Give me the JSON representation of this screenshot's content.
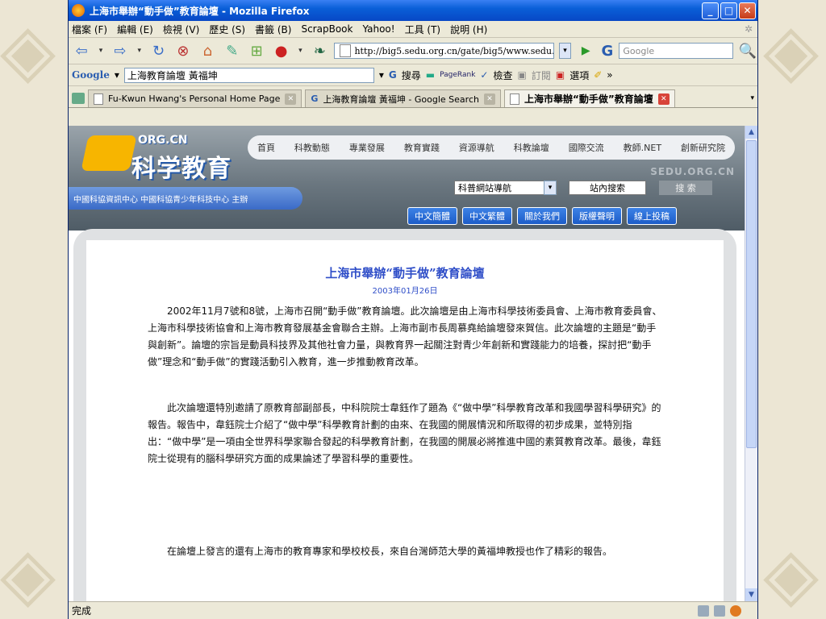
{
  "window": {
    "title": "上海市舉辦“動手做”教育論壇 - Mozilla Firefox"
  },
  "menu": [
    "檔案 (F)",
    "編輯 (E)",
    "檢視 (V)",
    "歷史 (S)",
    "書籤 (B)",
    "ScrapBook",
    "Yahoo!",
    "工具 (T)",
    "說明 (H)"
  ],
  "nav": {
    "url": "http://big5.sedu.org.cn/gate/big5/www.sedu.org",
    "search_placeholder": "Google"
  },
  "googlebar": {
    "logo": "Google",
    "query": "上海教育論壇 黃福坤",
    "search": "搜尋",
    "pagerank": "PageRank",
    "check": "檢查",
    "subscribe": "訂閱",
    "options": "選項",
    "more": "»"
  },
  "tabs": [
    {
      "label": "Fu-Kwun Hwang's Personal Home Page"
    },
    {
      "label": "上海教育論壇 黃福坤 - Google Search"
    },
    {
      "label": "上海市舉辦“動手做”教育論壇"
    }
  ],
  "site": {
    "logo_sub": "ORG.CN",
    "logo_text": "科学教育",
    "topnav": [
      "首頁",
      "科教動態",
      "專業發展",
      "教育實踐",
      "資源導航",
      "科教論壇",
      "國際交流",
      "教師.NET",
      "創新研究院"
    ],
    "domain_mark": "SEDU.ORG.CN",
    "org_note": "中國科協資訊中心 中國科協青少年科技中心 主辦",
    "select_value": "科普網站導航",
    "site_search": "站內搜索",
    "search_button": "搜 索",
    "pills": [
      "中文簡體",
      "中文繁體",
      "關於我們",
      "版權聲明",
      "線上投稿"
    ]
  },
  "article": {
    "title": "上海市舉辦“動手做”教育論壇",
    "date": "2003年01月26日",
    "paragraphs": [
      "2002年11月7號和8號，上海市召開“動手做”教育論壇。此次論壇是由上海市科學技術委員會、上海市教育委員會、上海市科學技術協會和上海市教育發展基金會聯合主辦。上海市副市長周慕堯給論壇發來賀信。此次論壇的主題是“動手與創新”。論壇的宗旨是動員科技界及其他社會力量，與教育界一起關注對青少年創新和實踐能力的培養，探討把“動手做”理念和“動手做”的實踐活動引入教育，進一步推動教育改革。",
      "此次論壇還特別邀請了原教育部副部長，中科院院士韋鈺作了題為《“做中學”科學教育改革和我國學習科學研究》的報告。報告中，韋鈺院士介紹了“做中學”科學教育計劃的由來、在我國的開展情況和所取得的初步成果，並特別指出：“做中學”是一項由全世界科學家聯合發起的科學教育計劃，在我國的開展必將推進中國的素質教育改革。最後，韋鈺院士從現有的腦科學研究方面的成果論述了學習科學的重要性。",
      "在論壇上發言的還有上海市的教育專家和學校校長，來自台灣師范大學的黃福坤教授也作了精彩的報告。"
    ]
  },
  "status": {
    "text": "完成"
  }
}
